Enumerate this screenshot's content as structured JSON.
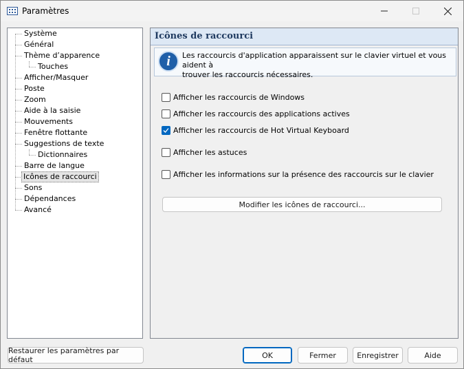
{
  "window": {
    "title": "Paramètres"
  },
  "tree": {
    "items": [
      {
        "label": "Système"
      },
      {
        "label": "Général"
      },
      {
        "label": "Thème d’apparence"
      },
      {
        "label": "Touches"
      },
      {
        "label": "Afficher/Masquer"
      },
      {
        "label": "Poste"
      },
      {
        "label": "Zoom"
      },
      {
        "label": "Aide à la saisie"
      },
      {
        "label": "Mouvements"
      },
      {
        "label": "Fenêtre flottante"
      },
      {
        "label": "Suggestions de texte"
      },
      {
        "label": "Dictionnaires"
      },
      {
        "label": "Barre de langue"
      },
      {
        "label": "Icônes de raccourci"
      },
      {
        "label": "Sons"
      },
      {
        "label": "Dépendances"
      },
      {
        "label": "Avancé"
      }
    ],
    "selected": "Icônes de raccourci"
  },
  "panel": {
    "title": "Icônes de raccourci",
    "info_line1": "Les raccourcis d'application apparaissent sur le clavier virtuel et vous aident à",
    "info_line2": "trouver les raccourcis nécessaires.",
    "checkboxes": [
      {
        "label": "Afficher les raccourcis de Windows",
        "checked": false
      },
      {
        "label": "Afficher les raccourcis des applications actives",
        "checked": false
      },
      {
        "label": "Afficher les raccourcis de Hot Virtual Keyboard",
        "checked": true
      },
      {
        "label": "Afficher les astuces",
        "checked": false
      },
      {
        "label": "Afficher les informations sur la présence des raccourcis sur le clavier",
        "checked": false
      }
    ],
    "modify_button": "Modifier les icônes de raccourci..."
  },
  "footer": {
    "restore": "Restaurer les paramètres par défaut",
    "ok": "OK",
    "close": "Fermer",
    "save": "Enregistrer",
    "help": "Aide"
  },
  "colors": {
    "accent": "#0067c0",
    "panel_header": "#dde8f5"
  }
}
